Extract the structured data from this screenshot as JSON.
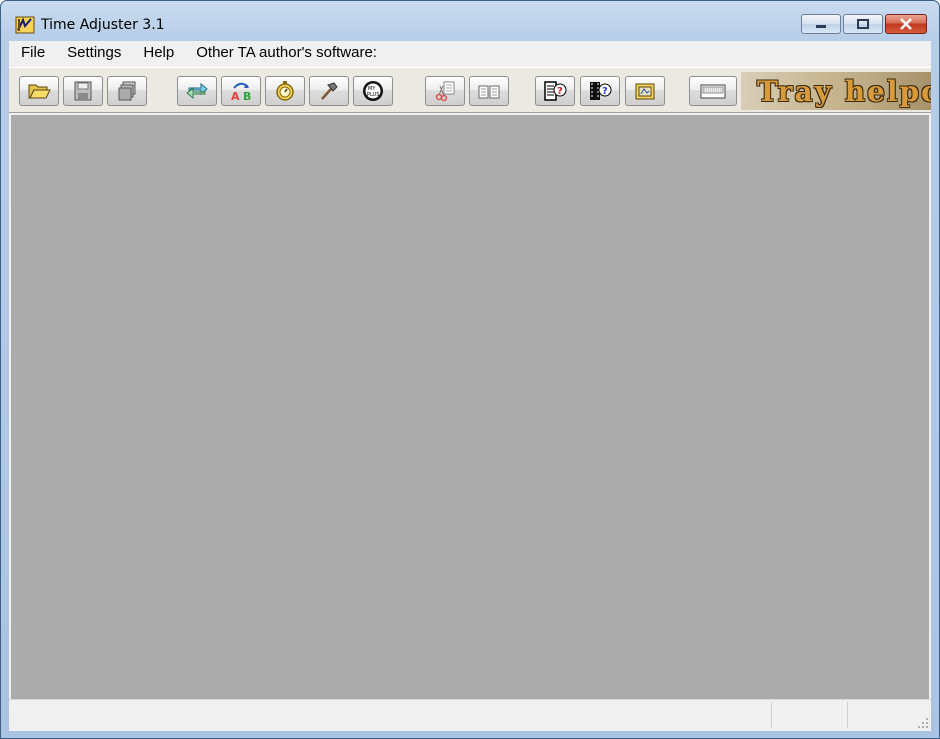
{
  "window": {
    "title": "Time Adjuster 3.1"
  },
  "menu": {
    "items": [
      "File",
      "Settings",
      "Help",
      "Other TA author's software:"
    ]
  },
  "toolbar": {
    "buttons": [
      {
        "name": "open-button",
        "icon": "folder-open-icon"
      },
      {
        "name": "save-button",
        "icon": "floppy-disk-icon"
      },
      {
        "name": "save-all-button",
        "icon": "stacked-windows-icon"
      },
      {
        "name": "sync-button",
        "icon": "double-arrow-icon"
      },
      {
        "name": "a-to-b-button",
        "icon": "a-b-arrow-icon"
      },
      {
        "name": "timer-button",
        "icon": "stopwatch-icon"
      },
      {
        "name": "tools-button",
        "icon": "hammer-icon"
      },
      {
        "name": "round-dial-button",
        "icon": "dial-icon"
      },
      {
        "name": "cut-button",
        "icon": "scissors-icon"
      },
      {
        "name": "copy-button",
        "icon": "copy-pages-icon"
      },
      {
        "name": "help-doc-button",
        "icon": "document-question-icon"
      },
      {
        "name": "help-film-button",
        "icon": "film-question-icon"
      },
      {
        "name": "image-button",
        "icon": "picture-frame-icon"
      },
      {
        "name": "tray-button",
        "icon": "keyboard-icon"
      }
    ],
    "banner_text": "Tray helpc"
  },
  "colors": {
    "workspace": "#ababab",
    "accent_banner": "#d99a3a"
  }
}
